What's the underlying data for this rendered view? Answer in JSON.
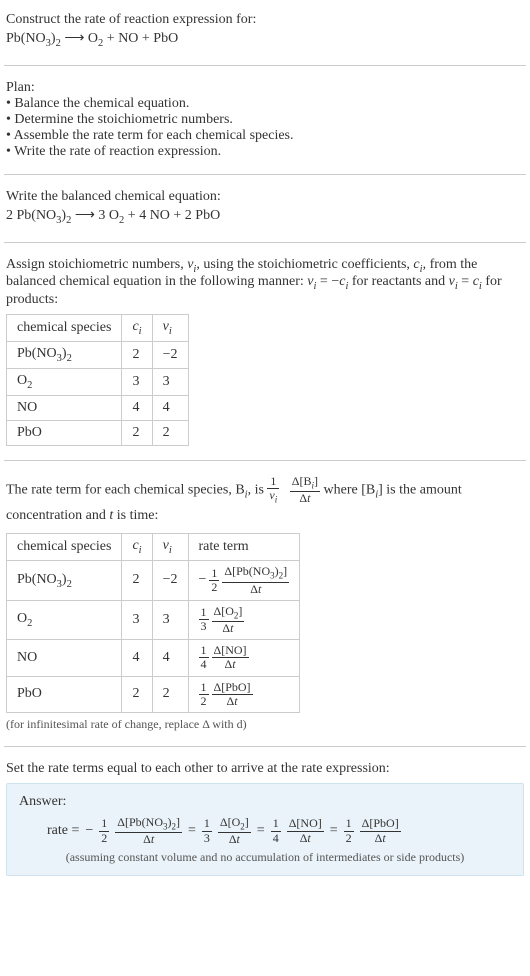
{
  "intro": {
    "line1": "Construct the rate of reaction expression for:",
    "eq_lhs": "Pb(NO",
    "eq_lhs_sub1": "3",
    "eq_lhs_paren": ")",
    "eq_lhs_sub2": "2",
    "arrow": " ⟶ ",
    "eq_rhs_o2_a": "O",
    "eq_rhs_o2_sub": "2",
    "eq_rhs_rest": " + NO + PbO"
  },
  "plan": {
    "heading": "Plan:",
    "b1": "• Balance the chemical equation.",
    "b2": "• Determine the stoichiometric numbers.",
    "b3": "• Assemble the rate term for each chemical species.",
    "b4": "• Write the rate of reaction expression."
  },
  "balanced": {
    "heading": "Write the balanced chemical equation:",
    "lhs_coef": "2 Pb(NO",
    "lhs_sub1": "3",
    "lhs_paren": ")",
    "lhs_sub2": "2",
    "arrow": " ⟶ ",
    "rhs_o2": "3 O",
    "rhs_o2_sub": "2",
    "rhs_rest": " + 4 NO + 2 PbO"
  },
  "assign": {
    "p1a": "Assign stoichiometric numbers, ",
    "nu": "ν",
    "sub_i": "i",
    "p1b": ", using the stoichiometric coefficients, ",
    "c": "c",
    "p1c": ", from the balanced chemical equation in the following manner: ",
    "eq1_lhs": "ν",
    "eq1_eq": " = −",
    "eq1_c": "c",
    "p1d": " for reactants and ",
    "eq2_lhs": "ν",
    "eq2_eq": " = ",
    "eq2_c": "c",
    "p1e": " for products:",
    "th_species": "chemical species",
    "th_ci": "c",
    "th_vi": "ν",
    "r1_sp_a": "Pb(NO",
    "r1_sp_s1": "3",
    "r1_sp_p": ")",
    "r1_sp_s2": "2",
    "r1_c": "2",
    "r1_v": "−2",
    "r2_sp_a": "O",
    "r2_sp_s": "2",
    "r2_c": "3",
    "r2_v": "3",
    "r3_sp": "NO",
    "r3_c": "4",
    "r3_v": "4",
    "r4_sp": "PbO",
    "r4_c": "2",
    "r4_v": "2"
  },
  "rateterm": {
    "p_a": "The rate term for each chemical species, B",
    "p_b": ", is ",
    "fr1_num": "1",
    "fr1_den_v": "ν",
    "fr2_num_a": "Δ[B",
    "fr2_num_b": "]",
    "fr2_den_a": "Δ",
    "fr2_den_t": "t",
    "p_c": " where [B",
    "p_d": "] is the amount concentration and ",
    "t": "t",
    "p_e": " is time:",
    "th_species": "chemical species",
    "th_ci": "c",
    "th_vi": "ν",
    "th_rate": "rate term",
    "r1_sp_a": "Pb(NO",
    "r1_sp_s1": "3",
    "r1_sp_p": ")",
    "r1_sp_s2": "2",
    "r1_c": "2",
    "r1_v": "−2",
    "r1_neg": "−",
    "r1_half_n": "1",
    "r1_half_d": "2",
    "r1_num_a": "Δ[Pb(NO",
    "r1_num_s1": "3",
    "r1_num_p": ")",
    "r1_num_s2": "2",
    "r1_num_b": "]",
    "r2_sp_a": "O",
    "r2_sp_s": "2",
    "r2_c": "3",
    "r2_v": "3",
    "r2_f_n": "1",
    "r2_f_d": "3",
    "r2_num_a": "Δ[O",
    "r2_num_s": "2",
    "r2_num_b": "]",
    "r3_sp": "NO",
    "r3_c": "4",
    "r3_v": "4",
    "r3_f_n": "1",
    "r3_f_d": "4",
    "r3_num": "Δ[NO]",
    "r4_sp": "PbO",
    "r4_c": "2",
    "r4_v": "2",
    "r4_f_n": "1",
    "r4_f_d": "2",
    "r4_num": "Δ[PbO]",
    "dt_a": "Δ",
    "dt_t": "t",
    "note": "(for infinitesimal rate of change, replace Δ with d)"
  },
  "final": {
    "heading": "Set the rate terms equal to each other to arrive at the rate expression:",
    "ans_label": "Answer:",
    "rate": "rate = ",
    "neg": "−",
    "half_n": "1",
    "half_d": "2",
    "t1_num_a": "Δ[Pb(NO",
    "t1_num_s1": "3",
    "t1_num_p": ")",
    "t1_num_s2": "2",
    "t1_num_b": "]",
    "eq": " = ",
    "third_n": "1",
    "third_d": "3",
    "t2_num_a": "Δ[O",
    "t2_num_s": "2",
    "t2_num_b": "]",
    "quarter_n": "1",
    "quarter_d": "4",
    "t3_num": "Δ[NO]",
    "half2_n": "1",
    "half2_d": "2",
    "t4_num": "Δ[PbO]",
    "dt_a": "Δ",
    "dt_t": "t",
    "note": "(assuming constant volume and no accumulation of intermediates or side products)"
  },
  "chart_data": null
}
